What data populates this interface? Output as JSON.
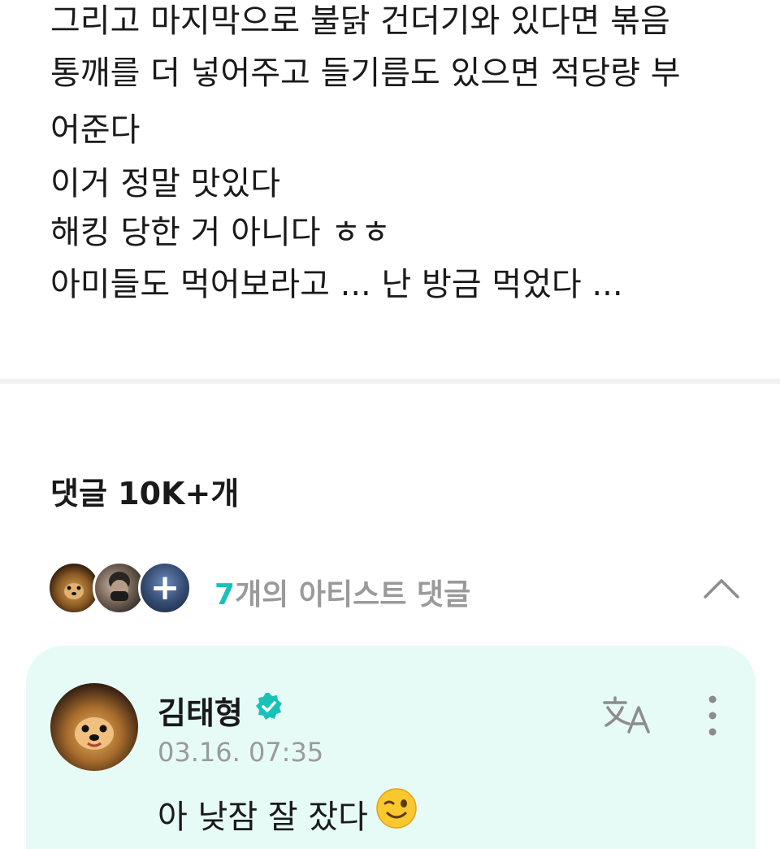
{
  "post": {
    "lines": [
      "그리고 마지막으로 불닭 건더기와 있다면 볶음",
      "통깨를 더 넣어주고 들기름도 있으면 적당량 부",
      "어준다",
      "이거 정말 맛있다",
      "해킹 당한 거 아니다 ㅎㅎ",
      "아미들도 먹어보라고 ... 난 방금 먹었다 ..."
    ]
  },
  "comments": {
    "header": "댓글 10K+개",
    "artist_summary": {
      "count": "7",
      "label": "개의 아티스트 댓글"
    },
    "items": [
      {
        "author": "김태형",
        "timestamp": "03.16. 07:35",
        "text": "아 낮잠 잘 잤다",
        "emoji": "wink-emoji"
      }
    ]
  },
  "icons": {
    "verified": "verified-badge-icon",
    "translate": "translate-icon",
    "more": "more-vertical-icon",
    "collapse": "chevron-up-icon"
  },
  "colors": {
    "accent": "#19c2b9",
    "card_background": "#e6faf6",
    "secondary_text": "#9a9a9a"
  }
}
